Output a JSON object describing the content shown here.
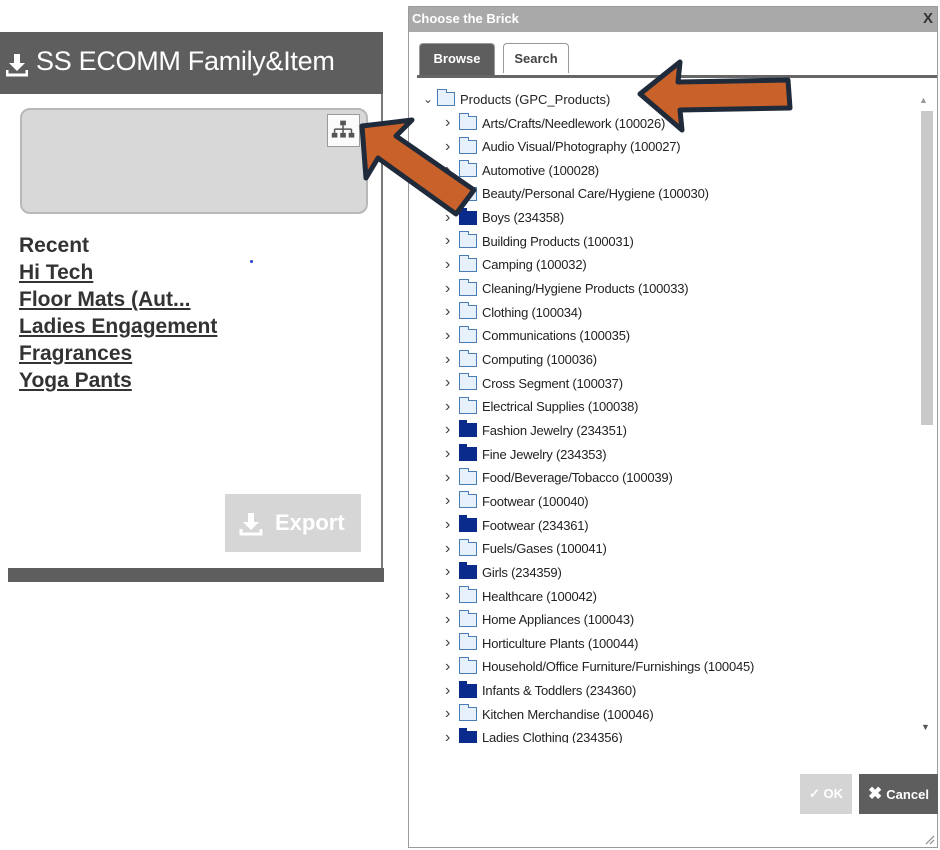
{
  "left_panel": {
    "title": "SS ECOMM Family&Item",
    "recent_heading": "Recent",
    "recent_links": [
      "Hi Tech",
      "Floor Mats (Aut...",
      "Ladies Engagement",
      "Fragrances",
      "Yoga Pants"
    ],
    "export_label": "Export"
  },
  "dialog": {
    "title": "Choose the Brick",
    "close_glyph": "X",
    "tabs": [
      "Browse",
      "Search"
    ],
    "active_tab": "Browse",
    "tree": {
      "root": "Products (GPC_Products)",
      "items": [
        {
          "label": "Arts/Crafts/Needlework (100026)",
          "folder": "light"
        },
        {
          "label": "Audio Visual/Photography (100027)",
          "folder": "light"
        },
        {
          "label": "Automotive (100028)",
          "folder": "light"
        },
        {
          "label": "Beauty/Personal Care/Hygiene (100030)",
          "folder": "light"
        },
        {
          "label": "Boys (234358)",
          "folder": "dark"
        },
        {
          "label": "Building Products (100031)",
          "folder": "light"
        },
        {
          "label": "Camping (100032)",
          "folder": "light"
        },
        {
          "label": "Cleaning/Hygiene Products (100033)",
          "folder": "light"
        },
        {
          "label": "Clothing (100034)",
          "folder": "light"
        },
        {
          "label": "Communications (100035)",
          "folder": "light"
        },
        {
          "label": "Computing (100036)",
          "folder": "light"
        },
        {
          "label": "Cross Segment (100037)",
          "folder": "light"
        },
        {
          "label": "Electrical Supplies (100038)",
          "folder": "light"
        },
        {
          "label": "Fashion Jewelry (234351)",
          "folder": "dark"
        },
        {
          "label": "Fine Jewelry (234353)",
          "folder": "dark"
        },
        {
          "label": "Food/Beverage/Tobacco (100039)",
          "folder": "light"
        },
        {
          "label": "Footwear (100040)",
          "folder": "light"
        },
        {
          "label": "Footwear (234361)",
          "folder": "dark"
        },
        {
          "label": "Fuels/Gases (100041)",
          "folder": "light"
        },
        {
          "label": "Girls (234359)",
          "folder": "dark"
        },
        {
          "label": "Healthcare (100042)",
          "folder": "light"
        },
        {
          "label": "Home Appliances (100043)",
          "folder": "light"
        },
        {
          "label": "Horticulture Plants (100044)",
          "folder": "light"
        },
        {
          "label": "Household/Office Furniture/Furnishings (100045)",
          "folder": "light"
        },
        {
          "label": "Infants & Toddlers (234360)",
          "folder": "dark"
        },
        {
          "label": "Kitchen Merchandise (100046)",
          "folder": "light"
        },
        {
          "label": "Ladies Clothing (234356)",
          "folder": "dark"
        }
      ]
    },
    "ok_label": "OK",
    "cancel_label": "Cancel"
  },
  "colors": {
    "header_gray": "#5e5e5e",
    "arrow_fill": "#c8622a",
    "arrow_outline": "#1f2a3a",
    "dark_folder": "#0a2a8c",
    "light_folder": "#e6f1fb"
  },
  "icons": [
    "download-icon",
    "hierarchy-icon",
    "folder-icon",
    "checkmark-icon",
    "close-icon",
    "chevron-right-icon",
    "chevron-down-icon",
    "resize-grip-icon"
  ]
}
